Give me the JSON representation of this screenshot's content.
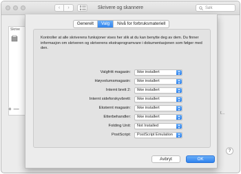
{
  "window": {
    "title": "Skrivere og skannere",
    "search_placeholder": "Søk",
    "nav_back": "‹",
    "nav_forward": "›"
  },
  "left_panel": {
    "label": "Skrive",
    "add": "+",
    "remove": "—"
  },
  "peek_text": "t...",
  "help_label": "?",
  "tabs": [
    {
      "label": "Generelt",
      "active": false
    },
    {
      "label": "Valg",
      "active": true
    },
    {
      "label": "Nivå for forbruksmateriell",
      "active": false
    }
  ],
  "description": "Kontroller at alle skriverens funksjoner vises her slik at du kan benytte deg av dem. Du finner informasjon om skriveren og skriverens ekstraprogramvare i dokumentasjonen som følger med den.",
  "options": [
    {
      "label": "Valgfritt magasin:",
      "value": "Ikke installert"
    },
    {
      "label": "Høyvolumsmagasin:",
      "value": "Ikke installert"
    },
    {
      "label": "Internt brett 2:",
      "value": "Ikke installert"
    },
    {
      "label": "Internt sideforskyvbrett:",
      "value": "Ikke installert"
    },
    {
      "label": "Eksternt magasin:",
      "value": "Ikke installert"
    },
    {
      "label": "Etterbehandler:",
      "value": "Ikke installert"
    },
    {
      "label": "Folding Unit:",
      "value": "Not Installed"
    },
    {
      "label": "PostScript:",
      "value": "PostScript Emulation"
    }
  ],
  "buttons": {
    "cancel": "Avbryt",
    "ok": "OK"
  },
  "colors": {
    "accent": "#2f83ee",
    "sheet_bg": "#ececec"
  }
}
